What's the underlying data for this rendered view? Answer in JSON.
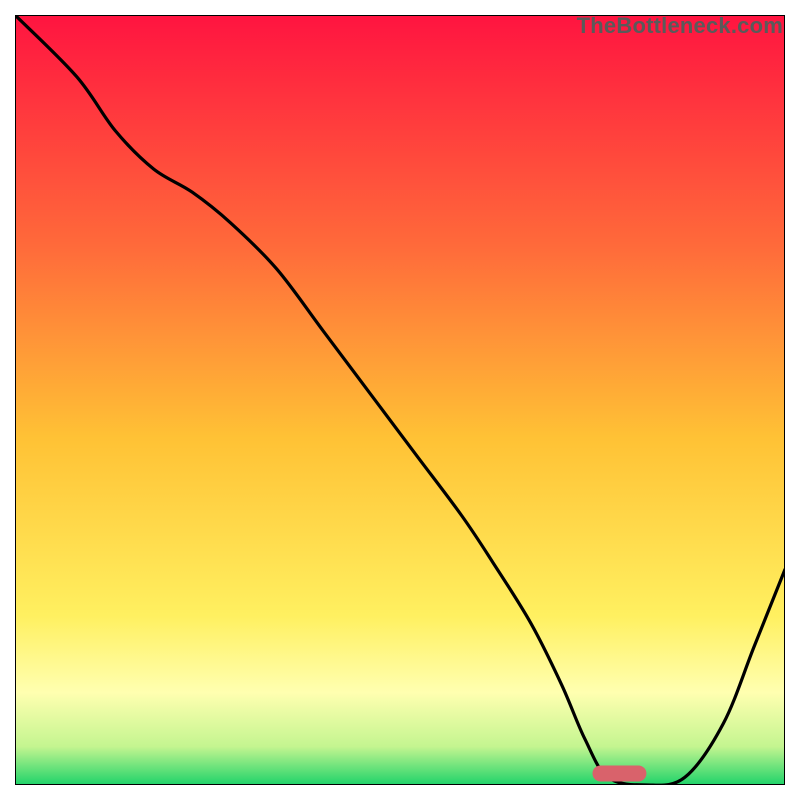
{
  "watermark": "TheBottleneck.com",
  "colors": {
    "gradient_top": "#ff1440",
    "gradient_mid_upper": "#ff7a3a",
    "gradient_mid": "#ffd335",
    "gradient_pale": "#ffff9e",
    "gradient_bottom": "#1fd36a",
    "curve": "#000000",
    "marker": "#d9626b",
    "frame": "#000000"
  },
  "chart_data": {
    "type": "line",
    "title": "",
    "xlabel": "",
    "ylabel": "",
    "xlim": [
      0,
      100
    ],
    "ylim": [
      0,
      100
    ],
    "grid": false,
    "series": [
      {
        "name": "bottleneck-curve",
        "x": [
          0,
          8,
          13,
          18,
          23,
          28,
          34,
          40,
          46,
          52,
          58,
          62,
          67,
          71,
          74,
          77,
          82,
          87,
          92,
          96,
          100
        ],
        "y": [
          100,
          92,
          85,
          80,
          77,
          73,
          67,
          59,
          51,
          43,
          35,
          29,
          21,
          13,
          6,
          1,
          0,
          1,
          8,
          18,
          28
        ]
      }
    ],
    "optimal_marker": {
      "x_start": 75,
      "x_end": 82,
      "y": 1.5
    },
    "background_gradient_stops": [
      {
        "offset": 0.0,
        "color": "#ff1440"
      },
      {
        "offset": 0.3,
        "color": "#ff6a3a"
      },
      {
        "offset": 0.55,
        "color": "#ffc235"
      },
      {
        "offset": 0.78,
        "color": "#fff060"
      },
      {
        "offset": 0.88,
        "color": "#ffffb0"
      },
      {
        "offset": 0.95,
        "color": "#c4f590"
      },
      {
        "offset": 1.0,
        "color": "#1fd36a"
      }
    ]
  }
}
